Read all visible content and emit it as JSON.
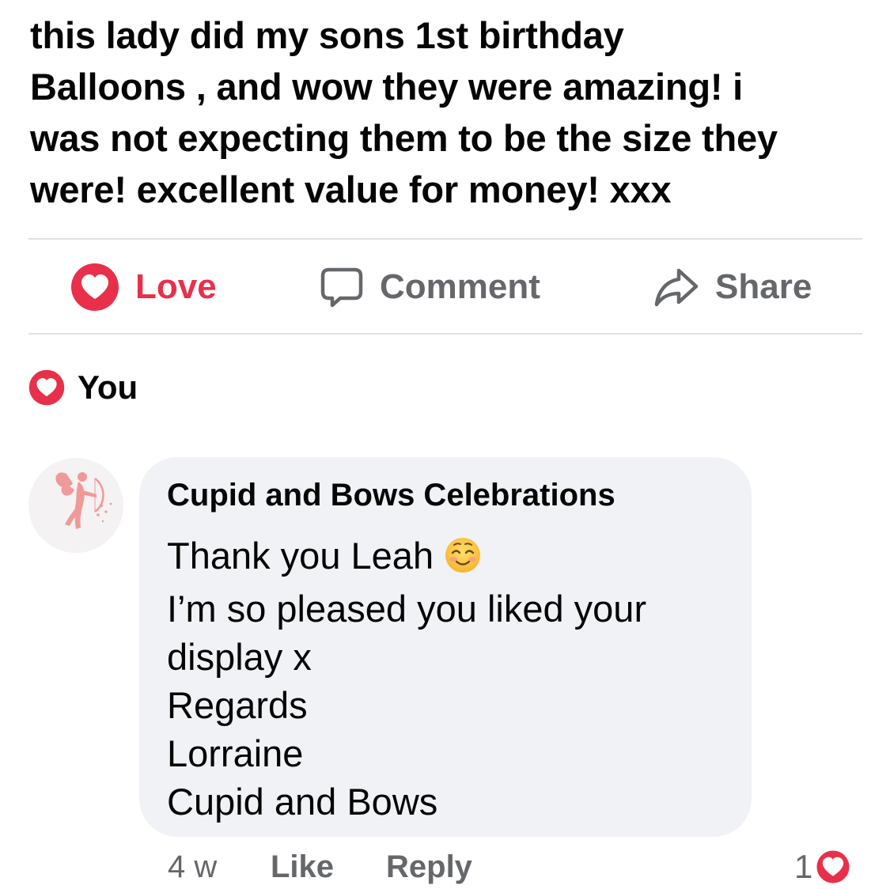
{
  "post": {
    "text_lines": [
      "this lady did my sons 1st birthday",
      "Balloons , and wow they were amazing! i",
      "was not expecting them to be the size they",
      "were! excellent value for money! xxx"
    ]
  },
  "actions": {
    "love_label": "Love",
    "comment_label": "Comment",
    "share_label": "Share"
  },
  "reactions": {
    "reactor_name": "You"
  },
  "comment": {
    "author": "Cupid and Bows Celebrations",
    "lines": [
      "Thank you Leah",
      "I’m so pleased you liked your",
      "display x",
      "Regards",
      "Lorraine",
      "Cupid and Bows"
    ],
    "timestamp": "4 w",
    "like_label": "Like",
    "reply_label": "Reply",
    "reaction_count": "1"
  },
  "icons": {
    "love": "heart-icon",
    "comment": "comment-bubble-icon",
    "share": "share-arrow-icon",
    "emoji": "smiling-face-emoji",
    "avatar": "cupid-logo"
  },
  "colors": {
    "love": "#e8304a",
    "secondary_text": "#65676b",
    "bubble": "#f0f2f5",
    "divider": "#dfe1e4"
  }
}
